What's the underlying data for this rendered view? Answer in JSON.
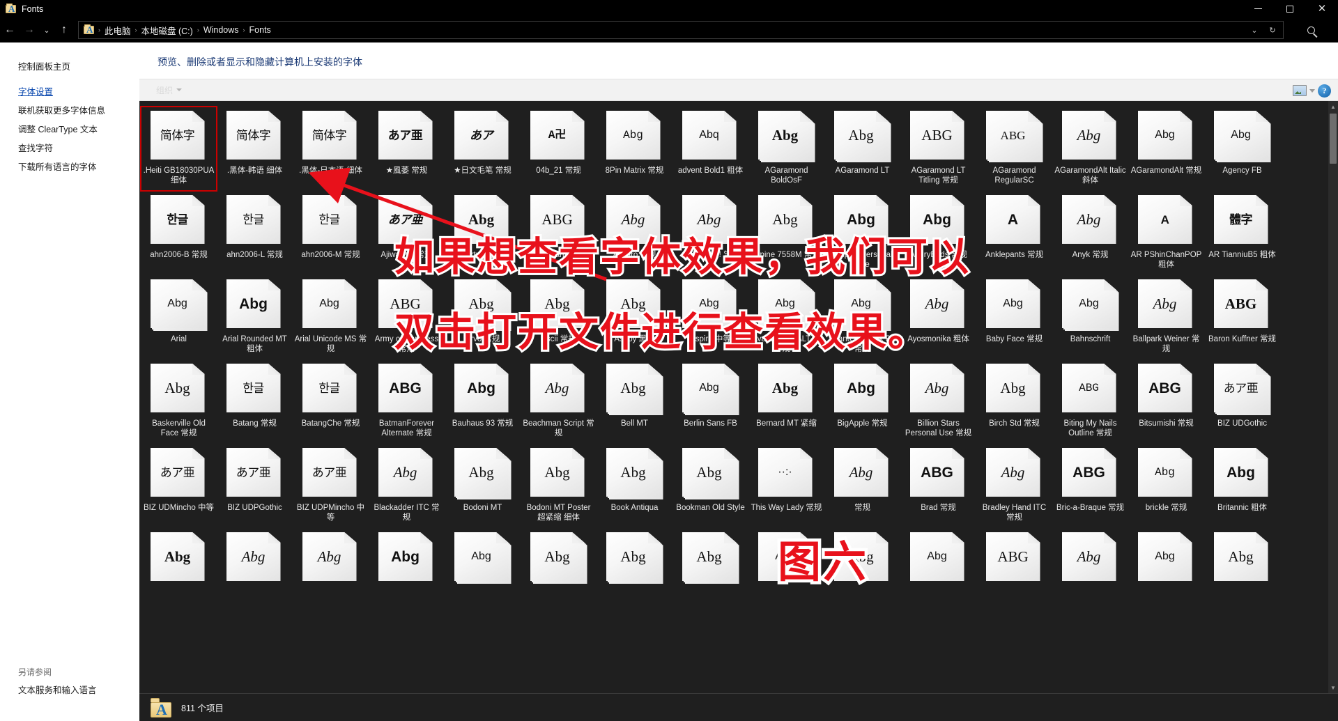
{
  "window": {
    "title": "Fonts",
    "icon": "fonts-folder-icon",
    "controls": {
      "minimize": "—",
      "maximize": "❐",
      "close": "✕"
    }
  },
  "nav": {
    "back": "←",
    "forward": "→",
    "recent": "⌄",
    "up": "↑",
    "breadcrumbs": [
      "此电脑",
      "本地磁盘 (C:)",
      "Windows",
      "Fonts"
    ],
    "separator": "›",
    "dropdown": "⌄",
    "refresh": "↻",
    "search_icon": "search-icon"
  },
  "sidebar": {
    "home": "控制面板主页",
    "links": [
      "字体设置",
      "联机获取更多字体信息",
      "调整 ClearType 文本",
      "查找字符",
      "下载所有语言的字体"
    ],
    "see_also_heading": "另请参阅",
    "see_also_links": [
      "文本服务和输入语言"
    ]
  },
  "content": {
    "title": "预览、删除或者显示和隐藏计算机上安装的字体",
    "toolbar": {
      "organize": "组织",
      "view_icon": "view-mode-icon",
      "help": "?"
    }
  },
  "status": {
    "items_text": "811 个项目",
    "icon": "fonts-folder-icon"
  },
  "annotations": {
    "line1": "如果想查看字体效果，我们可以",
    "line2": "双击打开文件进行查看效果。",
    "figure": "图六",
    "arrow": "red-arrow-pointing-to-first-font"
  },
  "fonts": [
    {
      "label": ".Heiti GB18030PUA 细体",
      "preview": "简体字",
      "style": "cjk",
      "stack": 1,
      "selected": true
    },
    {
      "label": ".黑体-韩语 细体",
      "preview": "简体字",
      "style": "cjk",
      "stack": 1
    },
    {
      "label": ".黑体-日本语 细体",
      "preview": "简体字",
      "style": "cjk",
      "stack": 1
    },
    {
      "label": "★風萎 常规",
      "preview": "あア亜",
      "style": "cjk bold",
      "stack": 1
    },
    {
      "label": "★日文毛笔 常规",
      "preview": "あア",
      "style": "cjk bold ital",
      "stack": 1
    },
    {
      "label": "04b_21 常规",
      "preview": "A卍",
      "style": "mono bold",
      "stack": 1
    },
    {
      "label": "8Pin Matrix 常规",
      "preview": "Abg",
      "style": "mono",
      "stack": 1
    },
    {
      "label": "advent Bold1 粗体",
      "preview": "Abq",
      "style": "small",
      "stack": 1
    },
    {
      "label": "AGaramond BoldOsF",
      "preview": "Abg",
      "style": "serif bold",
      "stack": 3
    },
    {
      "label": "AGaramond LT",
      "preview": "Abg",
      "style": "serif",
      "stack": 3
    },
    {
      "label": "AGaramond LT Titling 常规",
      "preview": "ABG",
      "style": "serif",
      "stack": 1
    },
    {
      "label": "AGaramond RegularSC",
      "preview": "ABG",
      "style": "scaps",
      "stack": 3
    },
    {
      "label": "AGaramondAlt Italic 斜体",
      "preview": "Abg",
      "style": "ital",
      "stack": 1
    },
    {
      "label": "AGaramondAlt 常规",
      "preview": "Abg",
      "style": "small",
      "stack": 1
    },
    {
      "label": "Agency FB",
      "preview": "Abg",
      "style": "small",
      "stack": 3
    },
    {
      "label": "ahn2006-B 常规",
      "preview": "한글",
      "style": "cjk bold",
      "stack": 1
    },
    {
      "label": "ahn2006-L 常规",
      "preview": "한글",
      "style": "cjk",
      "stack": 1
    },
    {
      "label": "ahn2006-M 常规",
      "preview": "한글",
      "style": "cjk",
      "stack": 1
    },
    {
      "label": "AjiwaiPro 常规",
      "preview": "あア亜",
      "style": "cjk bold ital",
      "stack": 1
    },
    {
      "label": "Albertus 超粗体",
      "preview": "Abg",
      "style": "serif bold",
      "stack": 1
    },
    {
      "label": "Algerian 常规",
      "preview": "ABG",
      "style": "serif",
      "stack": 1
    },
    {
      "label": "Allegro 常规",
      "preview": "Abg",
      "style": "ital",
      "stack": 1
    },
    {
      "label": "alliewriting! 常规",
      "preview": "Abg",
      "style": "ital",
      "stack": 1
    },
    {
      "label": "Alpine 7558M 常规",
      "preview": "Abg",
      "style": "serif",
      "stack": 1
    },
    {
      "label": "Amplify Personal Use",
      "preview": "Abg",
      "style": "bold",
      "stack": 1
    },
    {
      "label": "AngryBirds 常规",
      "preview": "Abg",
      "style": "bold",
      "stack": 1
    },
    {
      "label": "Anklepants 常规",
      "preview": "A",
      "style": "bold",
      "stack": 1
    },
    {
      "label": "Anyk 常规",
      "preview": "Abg",
      "style": "ital",
      "stack": 1
    },
    {
      "label": "AR PShinChanPOP 粗体",
      "preview": "A",
      "style": "cjk bold",
      "stack": 1
    },
    {
      "label": "AR TianniuB5 粗体",
      "preview": "體字",
      "style": "cjk bold",
      "stack": 1
    },
    {
      "label": "Arial",
      "preview": "Abg",
      "style": "small",
      "stack": 3
    },
    {
      "label": "Arial Rounded MT 粗体",
      "preview": "Abg",
      "style": "bold",
      "stack": 1
    },
    {
      "label": "Arial Unicode MS 常规",
      "preview": "Abg",
      "style": "small",
      "stack": 1
    },
    {
      "label": "Army of Darkness 常规",
      "preview": "ABG",
      "style": "serif",
      "stack": 1
    },
    {
      "label": "Arvo 常规",
      "preview": "Abg",
      "style": "serif",
      "stack": 3
    },
    {
      "label": "Ascii 常规",
      "preview": "Abg",
      "style": "serif",
      "stack": 1
    },
    {
      "label": "Ashby 黑体",
      "preview": "Abg",
      "style": "serif",
      "stack": 1
    },
    {
      "label": "Aspire 中等",
      "preview": "Abg",
      "style": "small",
      "stack": 1
    },
    {
      "label": "AvantGarde ALT 常规",
      "preview": "Abg",
      "style": "small",
      "stack": 3
    },
    {
      "label": "AvantGarde Bk BT 常规",
      "preview": "Abg",
      "style": "small",
      "stack": 3
    },
    {
      "label": "Ayosmonika 粗体",
      "preview": "Abg",
      "style": "ital",
      "stack": 1
    },
    {
      "label": "Baby Face 常规",
      "preview": "Abg",
      "style": "small",
      "stack": 1
    },
    {
      "label": "Bahnschrift",
      "preview": "Abg",
      "style": "small",
      "stack": 3
    },
    {
      "label": "Ballpark Weiner 常规",
      "preview": "Abg",
      "style": "ital",
      "stack": 1
    },
    {
      "label": "Baron Kuffner 常规",
      "preview": "ABG",
      "style": "serif bold",
      "stack": 1
    },
    {
      "label": "Baskerville Old Face 常规",
      "preview": "Abg",
      "style": "serif",
      "stack": 1
    },
    {
      "label": "Batang 常规",
      "preview": "한글",
      "style": "cjk",
      "stack": 1
    },
    {
      "label": "BatangChe 常规",
      "preview": "한글",
      "style": "cjk",
      "stack": 1
    },
    {
      "label": "BatmanForever Alternate 常规",
      "preview": "ABG",
      "style": "bold",
      "stack": 1
    },
    {
      "label": "Bauhaus 93 常规",
      "preview": "Abg",
      "style": "bold",
      "stack": 1
    },
    {
      "label": "Beachman Script 常规",
      "preview": "Abg",
      "style": "ital",
      "stack": 1
    },
    {
      "label": "Bell MT",
      "preview": "Abg",
      "style": "serif",
      "stack": 3
    },
    {
      "label": "Berlin Sans FB",
      "preview": "Abg",
      "style": "small",
      "stack": 3
    },
    {
      "label": "Bernard MT 紧缩",
      "preview": "Abg",
      "style": "serif bold",
      "stack": 1
    },
    {
      "label": "BigApple 常规",
      "preview": "Abg",
      "style": "bold",
      "stack": 1
    },
    {
      "label": "Billion Stars Personal Use 常规",
      "preview": "Abg",
      "style": "ital",
      "stack": 1
    },
    {
      "label": "Birch Std 常规",
      "preview": "Abg",
      "style": "serif",
      "stack": 1
    },
    {
      "label": "Biting My Nails Outline 常规",
      "preview": "ABG",
      "style": "mono",
      "stack": 1
    },
    {
      "label": "Bitsumishi 常规",
      "preview": "ABG",
      "style": "bold",
      "stack": 1
    },
    {
      "label": "BIZ UDGothic",
      "preview": "あア亜",
      "style": "cjk",
      "stack": 3
    },
    {
      "label": "BIZ UDMincho 中等",
      "preview": "あア亜",
      "style": "cjk serif",
      "stack": 1
    },
    {
      "label": "BIZ UDPGothic",
      "preview": "あア亜",
      "style": "cjk",
      "stack": 1
    },
    {
      "label": "BIZ UDPMincho 中等",
      "preview": "あア亜",
      "style": "cjk serif",
      "stack": 1
    },
    {
      "label": "Blackadder ITC 常规",
      "preview": "Abg",
      "style": "ital",
      "stack": 1
    },
    {
      "label": "Bodoni MT",
      "preview": "Abg",
      "style": "serif",
      "stack": 3
    },
    {
      "label": "Bodoni MT Poster 超紧缩 细体",
      "preview": "Abg",
      "style": "serif",
      "stack": 1
    },
    {
      "label": "Book Antiqua",
      "preview": "Abg",
      "style": "serif",
      "stack": 3
    },
    {
      "label": "Bookman Old Style",
      "preview": "Abg",
      "style": "serif",
      "stack": 3
    },
    {
      "label": "This Way Lady 常规",
      "preview": "··:·",
      "style": "small",
      "stack": 1
    },
    {
      "label": "常规",
      "preview": "Abg",
      "style": "ital",
      "stack": 1
    },
    {
      "label": "Brad 常规",
      "preview": "ABG",
      "style": "bold",
      "stack": 1
    },
    {
      "label": "Bradley Hand ITC 常规",
      "preview": "Abg",
      "style": "ital",
      "stack": 1
    },
    {
      "label": "Bric-a-Braque 常规",
      "preview": "ABG",
      "style": "bold",
      "stack": 1
    },
    {
      "label": "brickle 常规",
      "preview": "Abg",
      "style": "mono",
      "stack": 1
    },
    {
      "label": "Britannic 粗体",
      "preview": "Abg",
      "style": "bold",
      "stack": 1
    },
    {
      "label": "",
      "preview": "Abg",
      "style": "serif bold",
      "stack": 1
    },
    {
      "label": "",
      "preview": "Abg",
      "style": "ital",
      "stack": 1
    },
    {
      "label": "",
      "preview": "Abg",
      "style": "ital serif",
      "stack": 1
    },
    {
      "label": "",
      "preview": "Abg",
      "style": "bold",
      "stack": 1
    },
    {
      "label": "",
      "preview": "Abg",
      "style": "small",
      "stack": 3
    },
    {
      "label": "",
      "preview": "Abg",
      "style": "serif",
      "stack": 3
    },
    {
      "label": "",
      "preview": "Abg",
      "style": "serif",
      "stack": 3
    },
    {
      "label": "",
      "preview": "Abg",
      "style": "serif",
      "stack": 3
    },
    {
      "label": "",
      "preview": "Abg",
      "style": "small",
      "stack": 1
    },
    {
      "label": "",
      "preview": "Abg",
      "style": "serif",
      "stack": 1
    },
    {
      "label": "",
      "preview": "Abg",
      "style": "small",
      "stack": 1
    },
    {
      "label": "",
      "preview": "ABG",
      "style": "serif",
      "stack": 1
    },
    {
      "label": "",
      "preview": "Abg",
      "style": "ital",
      "stack": 1
    },
    {
      "label": "",
      "preview": "Abg",
      "style": "small",
      "stack": 1
    },
    {
      "label": "",
      "preview": "Abg",
      "style": "serif",
      "stack": 1
    }
  ]
}
